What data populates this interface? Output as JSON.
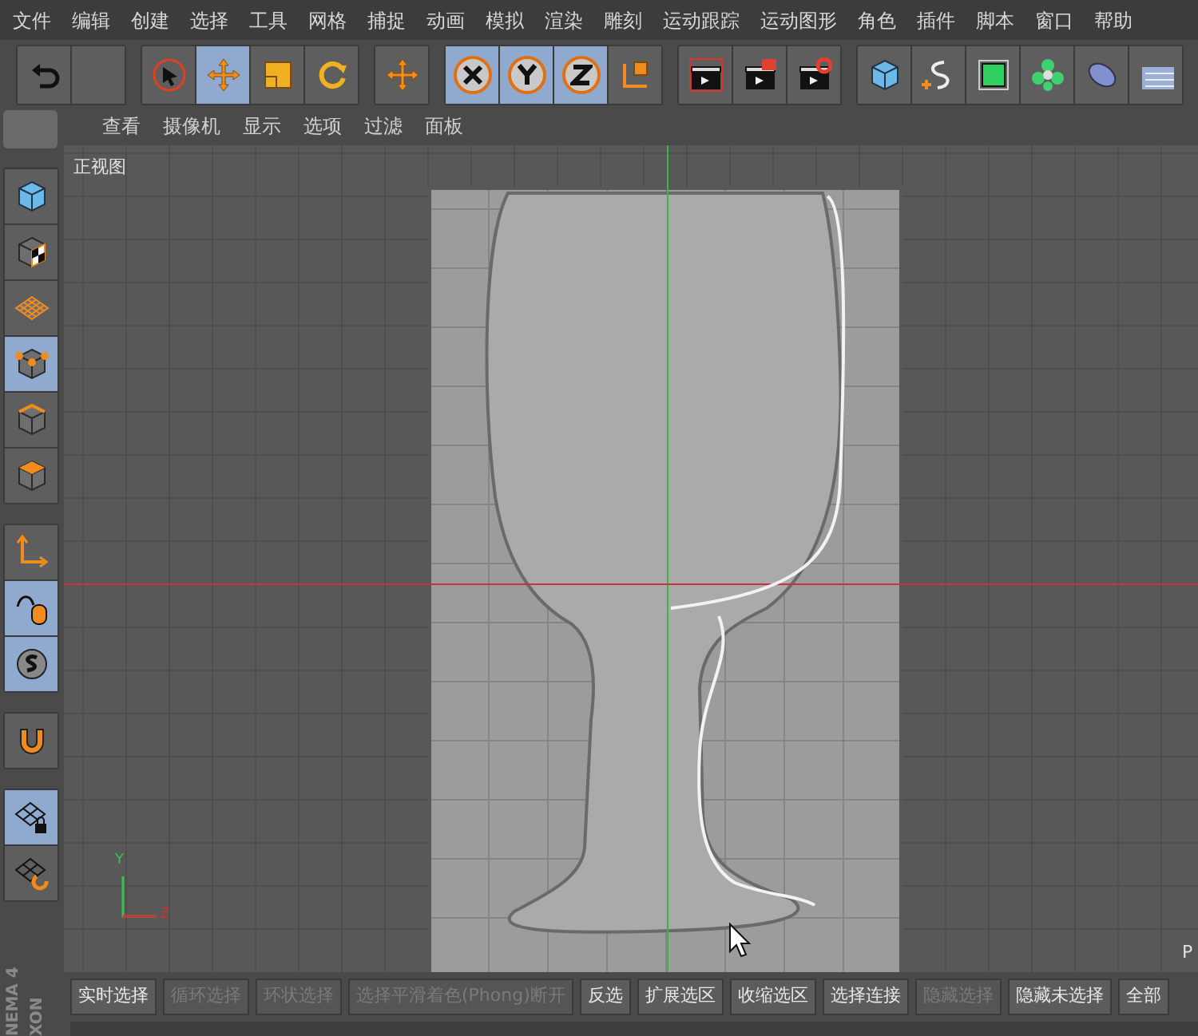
{
  "menu": [
    "文件",
    "编辑",
    "创建",
    "选择",
    "工具",
    "网格",
    "捕捉",
    "动画",
    "模拟",
    "渲染",
    "雕刻",
    "运动跟踪",
    "运动图形",
    "角色",
    "插件",
    "脚本",
    "窗口",
    "帮助"
  ],
  "toolbar": [
    [
      {
        "kind": "undo",
        "selected": false
      },
      {
        "kind": "empty",
        "selected": false
      }
    ],
    [
      {
        "kind": "select",
        "selected": false
      },
      {
        "kind": "move",
        "selected": true
      },
      {
        "kind": "scale",
        "selected": false
      },
      {
        "kind": "rotate",
        "selected": false
      }
    ],
    [
      {
        "kind": "move",
        "selected": false
      }
    ],
    [
      {
        "kind": "x",
        "selected": true
      },
      {
        "kind": "y",
        "selected": true
      },
      {
        "kind": "z",
        "selected": true
      },
      {
        "kind": "coord",
        "selected": false
      }
    ],
    [
      {
        "kind": "clap",
        "selected": false
      },
      {
        "kind": "clap-red",
        "selected": false
      },
      {
        "kind": "clap-gear",
        "selected": false
      }
    ],
    [
      {
        "kind": "cube",
        "selected": false
      },
      {
        "kind": "spline",
        "selected": false
      },
      {
        "kind": "green-cube",
        "selected": false
      },
      {
        "kind": "flower",
        "selected": false
      },
      {
        "kind": "capsule",
        "selected": false
      },
      {
        "kind": "plane",
        "selected": false
      }
    ]
  ],
  "view_menu": [
    "查看",
    "摄像机",
    "显示",
    "选项",
    "过滤",
    "面板"
  ],
  "left_toolbar": [
    [
      {
        "kind": "cube",
        "selected": false
      },
      {
        "kind": "checker",
        "selected": false
      },
      {
        "kind": "grid",
        "selected": false
      },
      {
        "kind": "points",
        "selected": true
      },
      {
        "kind": "edges",
        "selected": false
      },
      {
        "kind": "faces",
        "selected": false
      }
    ],
    [
      {
        "kind": "axis",
        "selected": false
      },
      {
        "kind": "mouse",
        "selected": true
      },
      {
        "kind": "s",
        "selected": true
      }
    ],
    [
      {
        "kind": "magnet",
        "selected": false
      }
    ],
    [
      {
        "kind": "grid-lock",
        "selected": true
      },
      {
        "kind": "grid-turn",
        "selected": false
      }
    ]
  ],
  "viewport": {
    "label": "正视图",
    "axis_labels": [
      "Y",
      "Z"
    ],
    "corner_text": "P"
  },
  "logo": [
    "XON",
    "NEMA 4"
  ],
  "selection_bar": [
    {
      "label": "实时选择",
      "disabled": false
    },
    {
      "label": "循环选择",
      "disabled": true
    },
    {
      "label": "环状选择",
      "disabled": true
    },
    {
      "label": "选择平滑着色(Phong)断开",
      "disabled": true
    },
    {
      "label": "反选",
      "disabled": false
    },
    {
      "label": "扩展选区",
      "disabled": false
    },
    {
      "label": "收缩选区",
      "disabled": false
    },
    {
      "label": "选择连接",
      "disabled": false
    },
    {
      "label": "隐藏选择",
      "disabled": true
    },
    {
      "label": "隐藏未选择",
      "disabled": false
    },
    {
      "label": "全部",
      "disabled": false
    }
  ]
}
